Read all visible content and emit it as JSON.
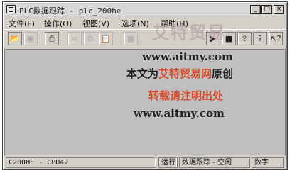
{
  "window": {
    "title": "PLC数据跟踪 - plc_200he",
    "minimize_glyph": "_",
    "maximize_glyph": "□",
    "close_glyph": "×"
  },
  "menubar": {
    "items": [
      {
        "label": "文件(F)",
        "disabled": false
      },
      {
        "label": "操作(O)",
        "disabled": false
      },
      {
        "label": "视图(V)",
        "disabled": false
      },
      {
        "label": "选项(N)",
        "disabled": false
      },
      {
        "label": "帮助(H)",
        "disabled": false
      }
    ]
  },
  "toolbar": {
    "buttons": [
      {
        "icon": "open-folder-icon",
        "glyph": "📂",
        "disabled": false
      },
      {
        "icon": "save-icon",
        "glyph": "▣",
        "disabled": true
      },
      {
        "icon": "print-preview-icon",
        "glyph": "⎙",
        "disabled": false
      },
      {
        "icon": "cut-icon",
        "glyph": "✂",
        "disabled": true
      },
      {
        "icon": "copy-icon",
        "glyph": "⧉",
        "disabled": true
      },
      {
        "icon": "paste-icon",
        "glyph": "📋",
        "disabled": true
      },
      {
        "icon": "trace-settings-icon",
        "glyph": "▦",
        "disabled": true
      },
      {
        "icon": "start-trace-icon",
        "glyph": "▶",
        "disabled": false
      },
      {
        "icon": "stop-trace-icon",
        "glyph": "■",
        "disabled": false
      },
      {
        "icon": "upload-icon",
        "glyph": "⇪",
        "disabled": false
      },
      {
        "icon": "help-icon",
        "glyph": "?",
        "disabled": false
      },
      {
        "icon": "context-help-icon",
        "glyph": "↖?",
        "disabled": false
      }
    ]
  },
  "statusbar": {
    "plc_model": "C200HE - CPU42",
    "run_mode": "运行",
    "trace_status": "数据跟踪 - 空闲",
    "num_lock": "数字"
  },
  "watermark": {
    "logo": "艾特贸易",
    "url": "www.aitmy.com",
    "note_prefix": "本文为",
    "note_highlight": "艾特贸易网",
    "note_suffix": "原创",
    "note2": "转载请注明出处"
  },
  "colors": {
    "client_bg": "#bfbfbf",
    "chrome": "#d4d0c8",
    "watermark_accent": "#d94a2a"
  }
}
